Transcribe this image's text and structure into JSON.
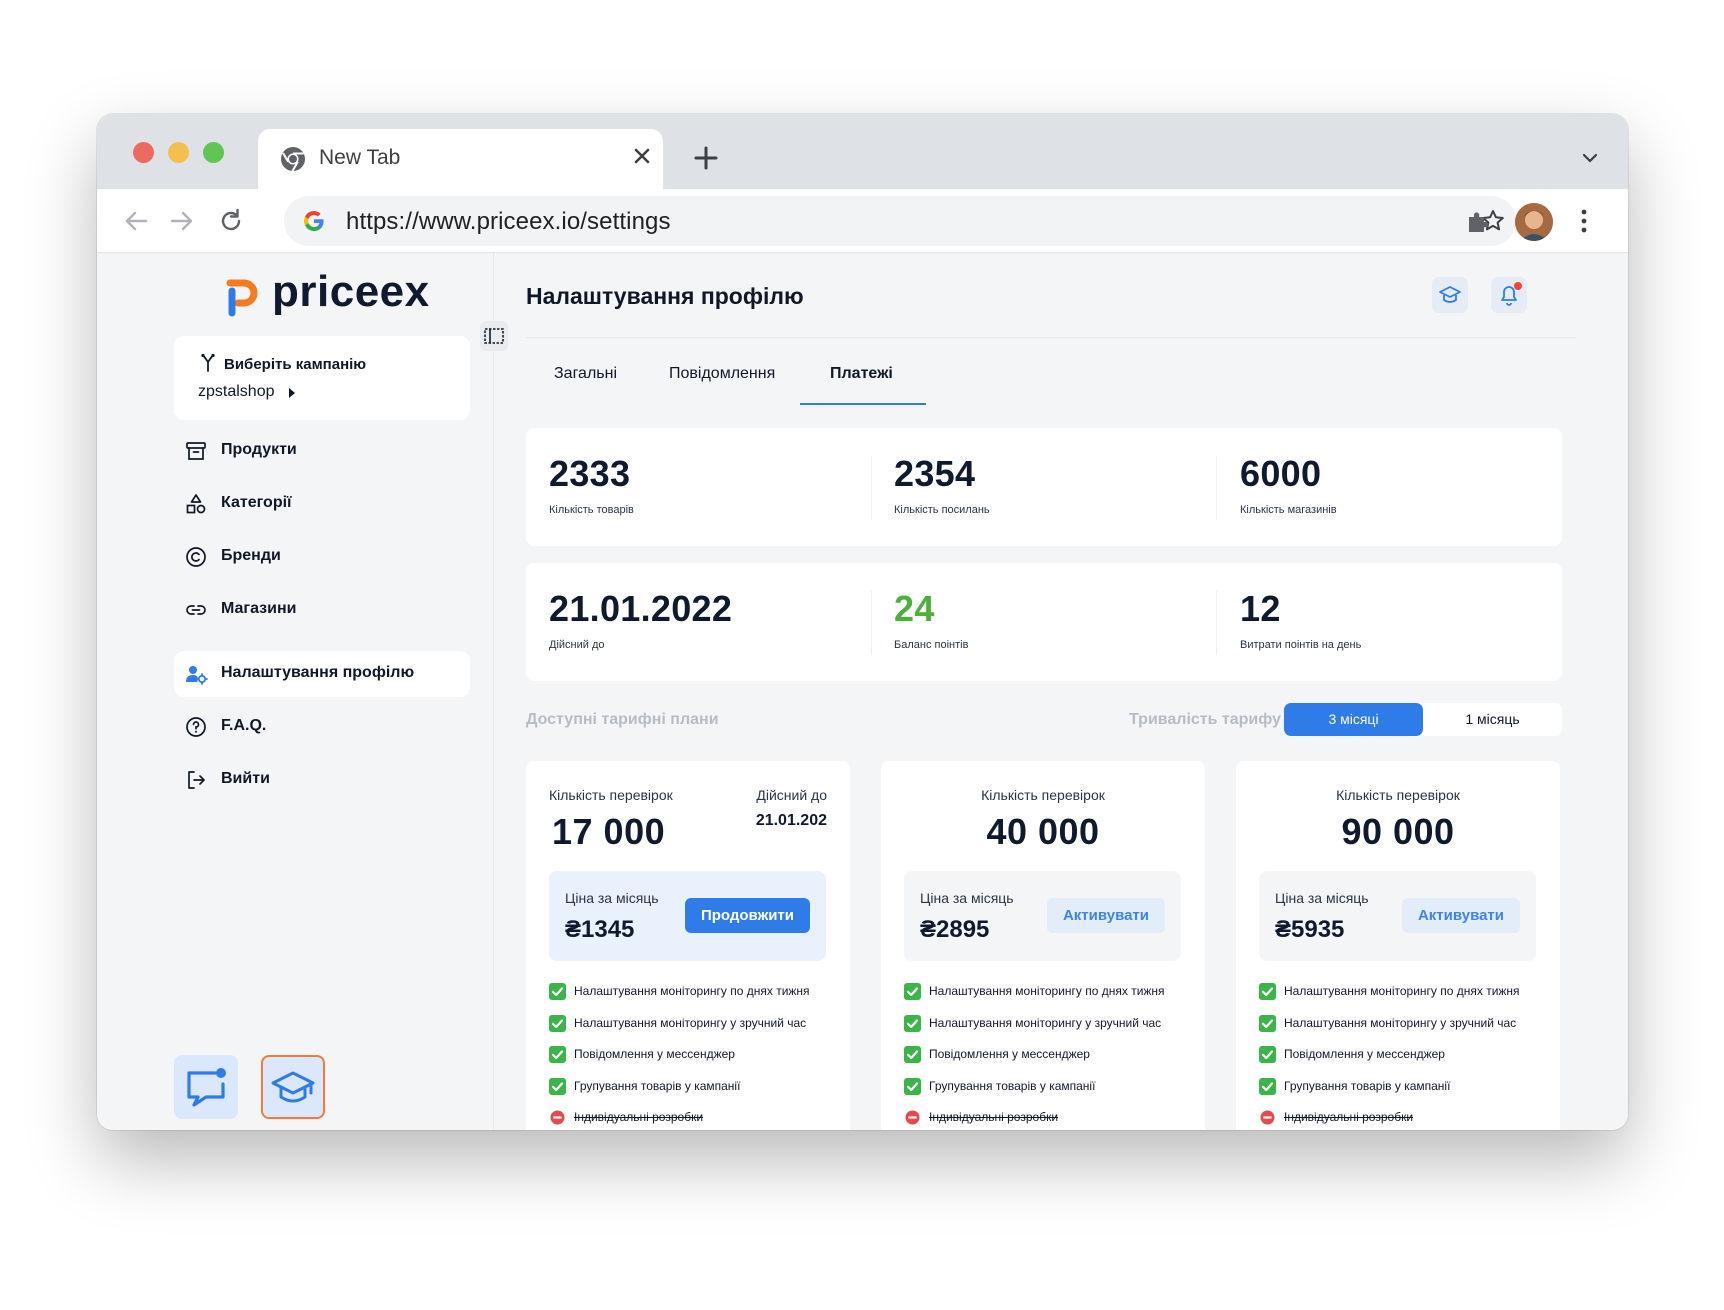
{
  "browser": {
    "tab_title": "New Tab",
    "url": "https://www.priceex.io/settings"
  },
  "sidebar": {
    "logo_text": "priceex",
    "campaign": {
      "label": "Виберіть кампанію",
      "value": "zpstalshop"
    },
    "nav": [
      {
        "label": "Продукти",
        "icon": "archive-box-icon"
      },
      {
        "label": "Категорії",
        "icon": "shapes-icon"
      },
      {
        "label": "Бренди",
        "icon": "copyright-icon"
      },
      {
        "label": "Магазини",
        "icon": "link-icon"
      },
      {
        "label": "Налаштування профілю",
        "icon": "user-settings-icon",
        "active": true
      },
      {
        "label": "F.A.Q.",
        "icon": "question-circle-icon"
      },
      {
        "label": "Вийти",
        "icon": "logout-icon"
      }
    ]
  },
  "header": {
    "title": "Налаштування профілю"
  },
  "tabs": [
    {
      "label": "Загальні"
    },
    {
      "label": "Повідомлення"
    },
    {
      "label": "Платежі",
      "active": true
    }
  ],
  "stats_row1": [
    {
      "value": "2333",
      "label": "Кількість товарів"
    },
    {
      "value": "2354",
      "label": "Кількість посилань"
    },
    {
      "value": "6000",
      "label": "Кількість магазинів"
    }
  ],
  "stats_row2": [
    {
      "value": "21.01.2022",
      "label": "Дійсний до"
    },
    {
      "value": "24",
      "label": "Баланс поінтів"
    },
    {
      "value": "12",
      "label": "Витрати поінтів на день"
    }
  ],
  "plans_section": {
    "title": "Доступні тарифні плани",
    "duration_label": "Тривалість тарифу",
    "duration_options": [
      "3 місяці",
      "1 місяць"
    ],
    "selected_duration": "3 місяці"
  },
  "plans": [
    {
      "checks_label": "Кількість перевірок",
      "checks": "17 000",
      "valid_label": "Дійсний до",
      "valid_value": "21.01.202",
      "price_label": "Ціна за місяць",
      "price": "₴1345",
      "button": "Продовжити",
      "current": true
    },
    {
      "checks_label": "Кількість перевірок",
      "checks": "40 000",
      "price_label": "Ціна за місяць",
      "price": "₴2895",
      "button": "Активувати"
    },
    {
      "checks_label": "Кількість перевірок",
      "checks": "90 000",
      "price_label": "Ціна за місяць",
      "price": "₴5935",
      "button": "Активувати"
    }
  ],
  "features": [
    {
      "text": "Налаштування моніторингу по днях тижня",
      "included": true
    },
    {
      "text": "Налаштування моніторингу у зручний час",
      "included": true
    },
    {
      "text": "Повідомлення у мессенджер",
      "included": true
    },
    {
      "text": "Групування товарів у кампанії",
      "included": true
    },
    {
      "text": "Індивідуальні розробки",
      "included": false
    }
  ],
  "colors": {
    "accent": "#2f7ce9",
    "positive": "#4cb13a",
    "check": "#3bb54a",
    "excluded": "#e5484d"
  }
}
